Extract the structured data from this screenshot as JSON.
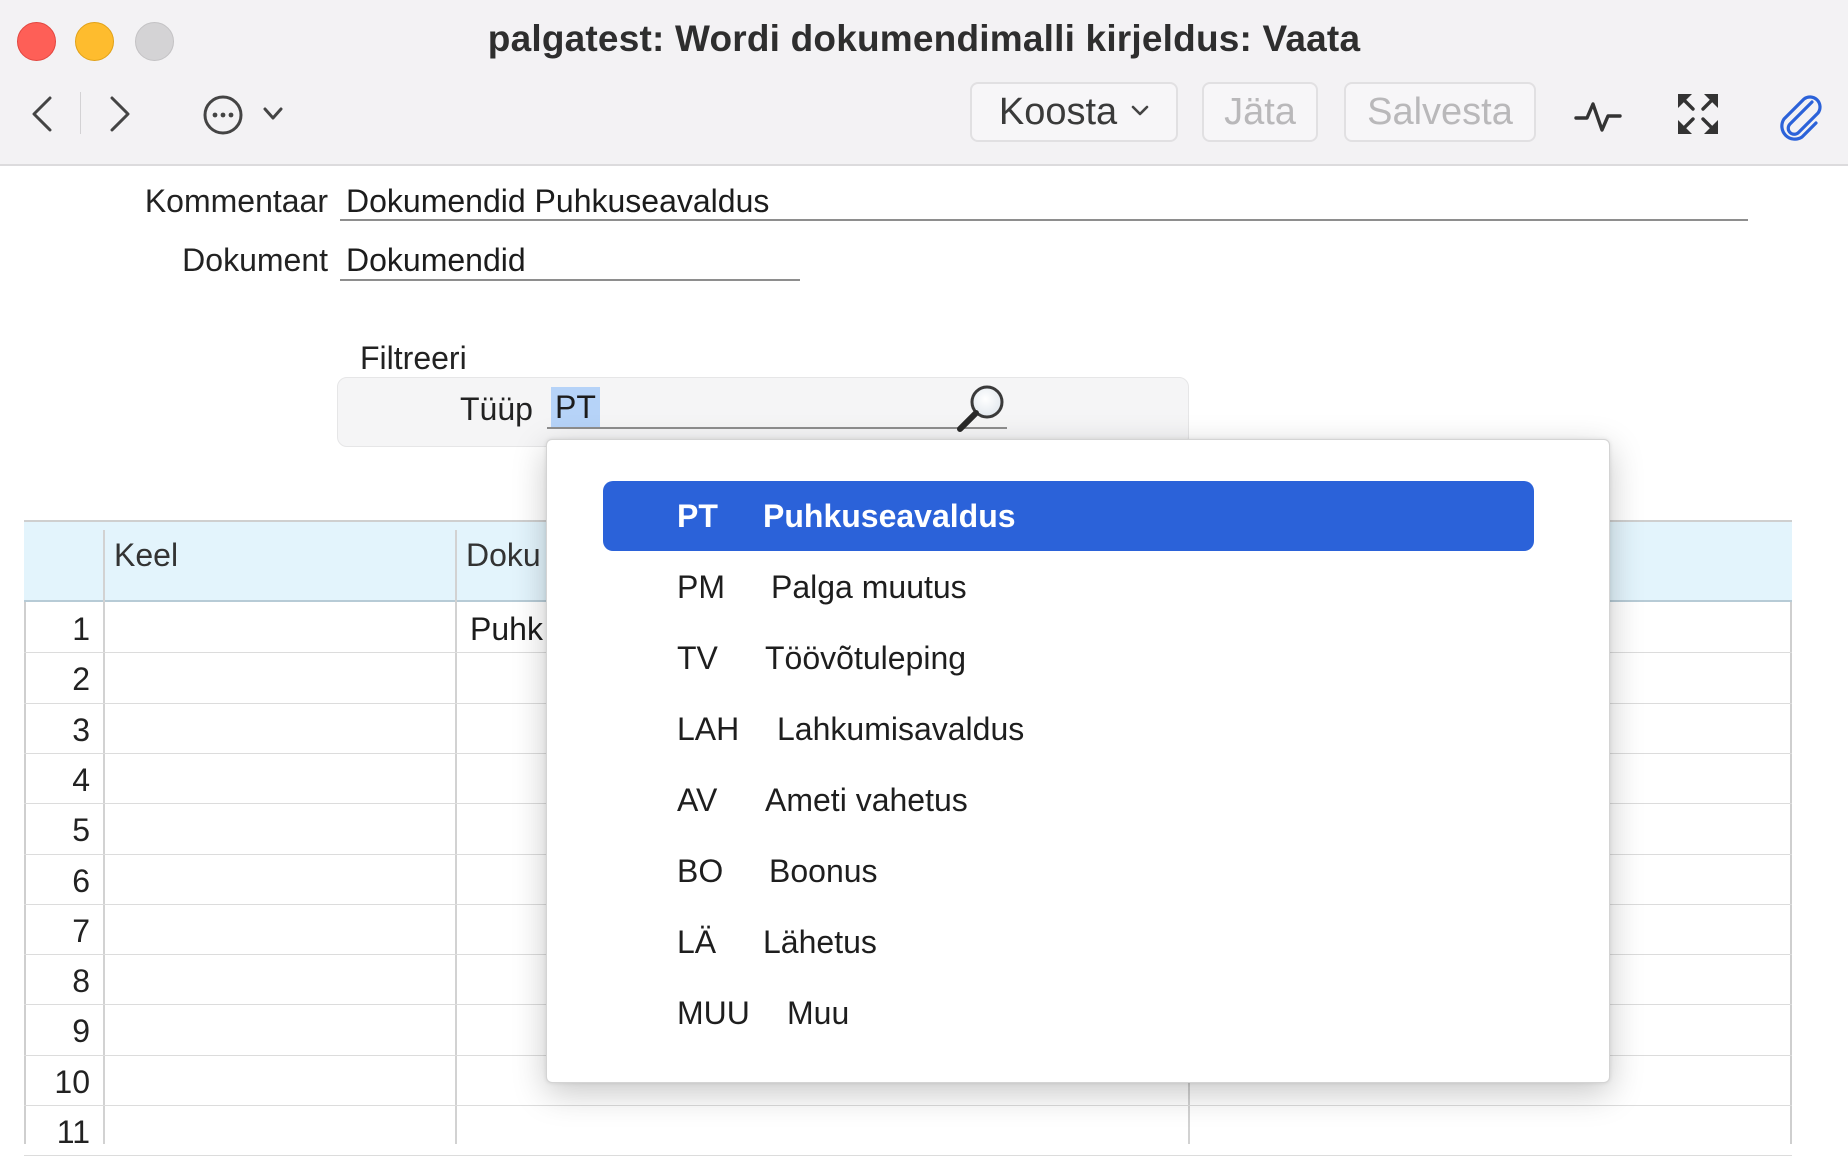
{
  "window": {
    "title": "palgatest: Wordi dokumendimalli kirjeldus: Vaata"
  },
  "toolbar": {
    "koosta_label": "Koosta",
    "jata_label": "Jäta",
    "salvesta_label": "Salvesta",
    "icons": [
      "chevron-left-icon",
      "chevron-right-icon",
      "more-options-icon",
      "chevron-down-icon",
      "activity-icon",
      "fullscreen-icon",
      "paperclip-icon"
    ]
  },
  "form": {
    "kommentaar_label": "Kommentaar",
    "kommentaar_value": "Dokumendid Puhkuseavaldus",
    "dokument_label": "Dokument",
    "dokument_value": "Dokumendid"
  },
  "filter": {
    "title": "Filtreeri",
    "tyyp_label": "Tüüp",
    "tyyp_value": "PT"
  },
  "table": {
    "columns": [
      "Keel",
      "Doku"
    ],
    "rows": [
      "1",
      "2",
      "3",
      "4",
      "5",
      "6",
      "7",
      "8",
      "9",
      "10",
      "11"
    ],
    "row1_doc": "Puhk"
  },
  "dropdown": {
    "selected_index": 0,
    "options": [
      {
        "code": "PT",
        "name": "Puhkuseavaldus"
      },
      {
        "code": "PM",
        "name": "Palga muutus"
      },
      {
        "code": "TV",
        "name": "Töövõtuleping"
      },
      {
        "code": "LAH",
        "name": "Lahkumisavaldus"
      },
      {
        "code": "AV",
        "name": "Ameti vahetus"
      },
      {
        "code": "BO",
        "name": "Boonus"
      },
      {
        "code": "LÄ",
        "name": "Lähetus"
      },
      {
        "code": "MUU",
        "name": "Muu"
      }
    ]
  },
  "colors": {
    "accent": "#2b62d9",
    "selection": "#b6d3f8",
    "table_header": "#e3f4fc",
    "close": "#fe5f57",
    "minimize": "#febc2e"
  }
}
